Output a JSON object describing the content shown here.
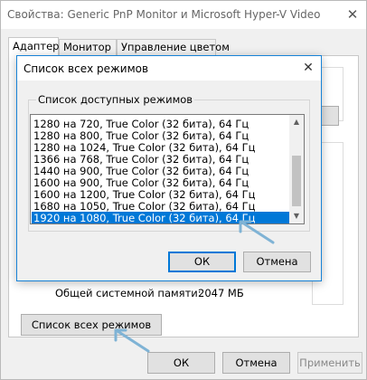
{
  "window": {
    "title": "Свойства: Generic PnP Monitor и Microsoft Hyper-V Video",
    "close_glyph": "✕"
  },
  "tabs": [
    {
      "label": "Адаптер",
      "active": true
    },
    {
      "label": "Монитор",
      "active": false
    },
    {
      "label": "Управление цветом",
      "active": false
    }
  ],
  "adapter": {
    "system_memory_label": "Общей системной памяти:",
    "system_memory_value": "2047 МБ",
    "list_all_modes_button": "Список всех режимов"
  },
  "footer": {
    "ok": "ОК",
    "cancel": "Отмена",
    "apply": "Применить"
  },
  "dialog": {
    "title": "Список всех режимов",
    "close_glyph": "✕",
    "group_label": "Список доступных режимов",
    "modes": [
      "1280 на 720, True Color (32 бита), 64 Гц",
      "1280 на 800, True Color (32 бита), 64 Гц",
      "1280 на 1024, True Color (32 бита), 64 Гц",
      "1366 на 768, True Color (32 бита), 64 Гц",
      "1440 на 900, True Color (32 бита), 64 Гц",
      "1600 на 900, True Color (32 бита), 64 Гц",
      "1600 на 1200, True Color (32 бита), 64 Гц",
      "1680 на 1050, True Color (32 бита), 64 Гц",
      "1920 на 1080, True Color (32 бита), 64 Гц"
    ],
    "selected_index": 8,
    "ok": "ОК",
    "cancel": "Отмена"
  },
  "colors": {
    "selection": "#0078d7",
    "annotation_arrow": "#7fb3d5"
  }
}
